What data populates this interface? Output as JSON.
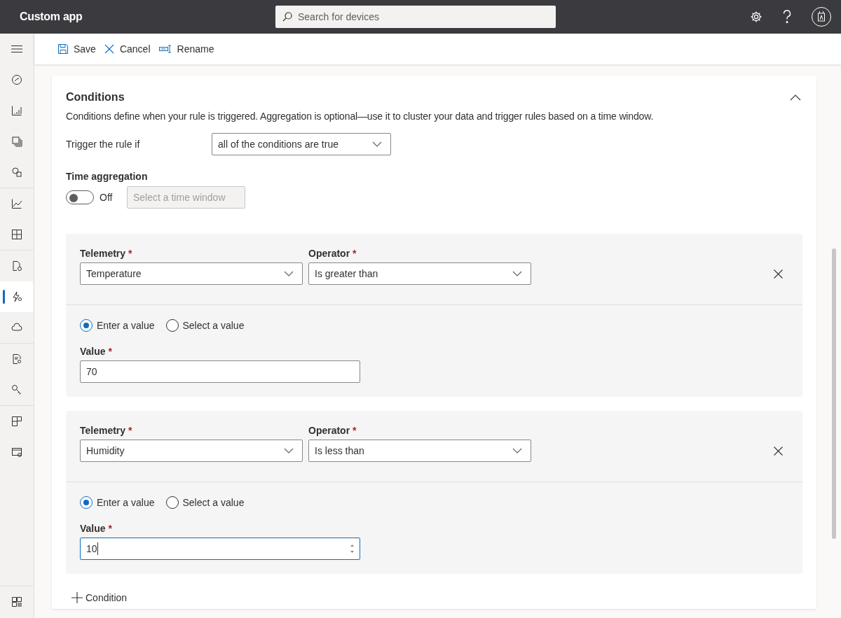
{
  "app": {
    "title": "Custom app",
    "search_placeholder": "Search for devices"
  },
  "sidebar": {
    "groups": [
      [
        {
          "kind": "dashboard",
          "selected": false
        },
        {
          "kind": "analytics",
          "selected": false
        },
        {
          "kind": "devices",
          "selected": false
        },
        {
          "kind": "groups",
          "selected": false
        }
      ],
      [
        {
          "kind": "chart",
          "selected": false
        },
        {
          "kind": "grid",
          "selected": false
        }
      ],
      [
        {
          "kind": "template",
          "selected": false
        },
        {
          "kind": "rules",
          "selected": true
        },
        {
          "kind": "cloud",
          "selected": false
        }
      ],
      [
        {
          "kind": "report",
          "selected": false
        },
        {
          "kind": "key",
          "selected": false
        }
      ],
      [
        {
          "kind": "layout",
          "selected": false
        },
        {
          "kind": "settings",
          "selected": false
        }
      ]
    ],
    "bottom": {
      "kind": "customize",
      "selected": false
    }
  },
  "commands": [
    {
      "kind": "save",
      "label": "Save"
    },
    {
      "kind": "cancel",
      "label": "Cancel"
    },
    {
      "kind": "rename",
      "label": "Rename"
    }
  ],
  "conditions": {
    "title": "Conditions",
    "expanded": true,
    "description": "Conditions define when your rule is triggered. Aggregation is optional—use it to cluster your data and trigger rules based on a time window.",
    "trigger_label": "Trigger the rule if",
    "trigger_value": "all of the conditions are true",
    "aggregation_label": "Time aggregation",
    "aggregation_on": false,
    "aggregation_state": "Off",
    "time_window_placeholder": "Select a time window",
    "items": [
      {
        "required_mark": "*",
        "telemetry_label": "Telemetry",
        "telemetry": "Temperature",
        "operator_label": "Operator",
        "operator": "Is greater than",
        "options": [
          {
            "label": "Enter a value",
            "selected": true
          },
          {
            "label": "Select a value",
            "selected": false
          }
        ],
        "value_label": "Value",
        "value": "70",
        "focused": false
      },
      {
        "required_mark": "*",
        "telemetry_label": "Telemetry",
        "telemetry": "Humidity",
        "operator_label": "Operator",
        "operator": "Is less than",
        "options": [
          {
            "label": "Enter a value",
            "selected": true
          },
          {
            "label": "Select a value",
            "selected": false
          }
        ],
        "value_label": "Value",
        "value": "10",
        "focused": true
      }
    ],
    "add_label": "Condition"
  }
}
